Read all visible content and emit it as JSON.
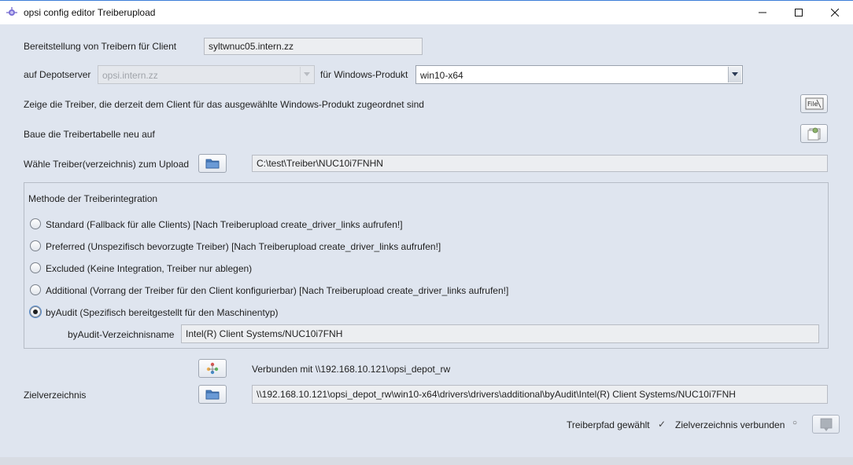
{
  "window": {
    "title": "opsi config editor Treiberupload",
    "minimize_icon": "minimize-icon",
    "maximize_icon": "maximize-icon",
    "close_icon": "close-icon"
  },
  "client": {
    "label": "Bereitstellung von Treibern für Client",
    "value": "syltwnuc05.intern.zz"
  },
  "depot": {
    "label": "auf Depotserver",
    "value": "opsi.intern.zz"
  },
  "product": {
    "label": "für Windows-Produkt",
    "value": "win10-x64"
  },
  "show_drivers": {
    "label": "Zeige die Treiber, die derzeit dem Client für das ausgewählte Windows-Produkt zugeordnet sind",
    "icon": "file-icon"
  },
  "rebuild": {
    "label": "Baue die Treibertabelle neu auf",
    "icon": "rebuild-icon"
  },
  "upload_dir": {
    "label": "Wähle Treiber(verzeichnis) zum Upload",
    "value": "C:\\test\\Treiber\\NUC10i7FNHN",
    "icon": "folder-icon"
  },
  "method": {
    "title": "Methode der Treiberintegration",
    "options": [
      {
        "label": "Standard (Fallback für alle Clients) [Nach Treiberupload create_driver_links aufrufen!]",
        "selected": false
      },
      {
        "label": "Preferred (Unspezifisch bevorzugte Treiber) [Nach Treiberupload create_driver_links aufrufen!]",
        "selected": false
      },
      {
        "label": "Excluded (Keine Integration, Treiber nur ablegen)",
        "selected": false
      },
      {
        "label": "Additional (Vorrang der Treiber für den Client konfigurierbar) [Nach Treiberupload create_driver_links aufrufen!]",
        "selected": false
      },
      {
        "label": "byAudit (Spezifisch bereitgestellt für den Maschinentyp)",
        "selected": true
      }
    ],
    "byaudit_label": "byAudit-Verzeichnisname",
    "byaudit_value": "Intel(R) Client Systems/NUC10i7FNH"
  },
  "connection": {
    "status": "Verbunden mit \\\\192.168.10.121\\opsi_depot_rw",
    "icon": "connect-icon"
  },
  "target": {
    "label": "Zielverzeichnis",
    "value": "\\\\192.168.10.121\\opsi_depot_rw\\win10-x64\\drivers\\drivers\\additional\\byAudit\\Intel(R) Client Systems/NUC10i7FNH",
    "icon": "folder-icon"
  },
  "status_bar": {
    "driver_path_label": "Treiberpfad gewählt",
    "driver_path_mark": "✓",
    "target_label": "Zielverzeichnis verbunden",
    "target_mark": "○",
    "upload_icon": "upload-icon"
  }
}
